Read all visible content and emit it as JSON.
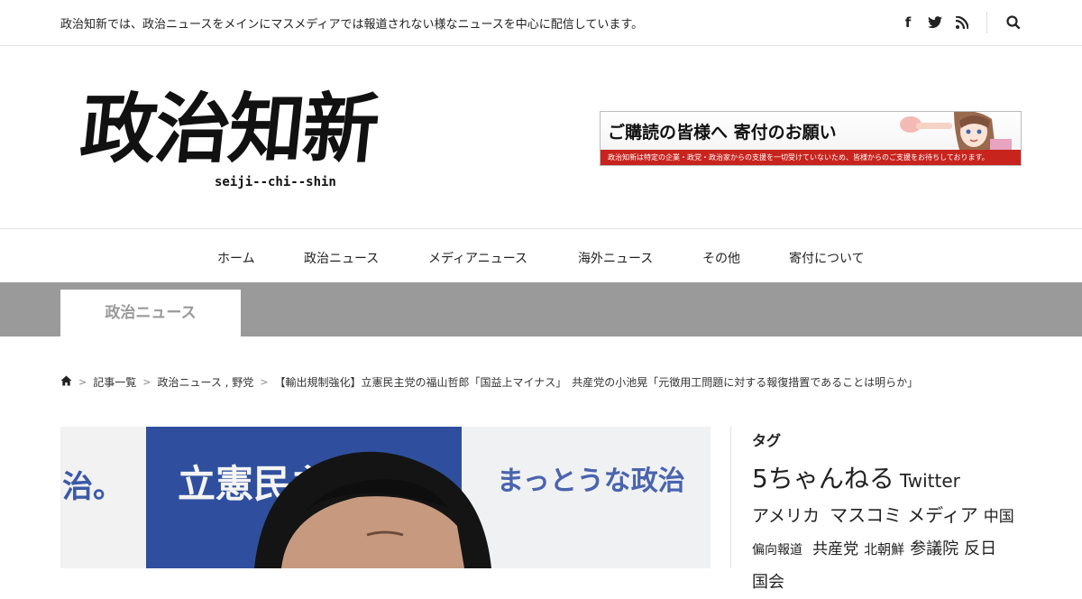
{
  "topbar": {
    "tagline": "政治知新では、政治ニュースをメインにマスメディアでは報道されない様なニュースを中心に配信しています。",
    "icons": [
      "facebook-icon",
      "twitter-icon",
      "rss-icon",
      "search-icon"
    ],
    "facebook_glyph": "f",
    "twitter_glyph": "🐦",
    "rss_glyph": "◉",
    "search_glyph": "⌕"
  },
  "header": {
    "logo_text": "政治知新",
    "logo_subtext": "seiji--chi--shin",
    "banner": {
      "title": "ご購読の皆様へ 寄付のお願い",
      "strip": "政治知新は特定の企業・政党・政治家からの支援を一切受けていないため、皆様からのご支援をお待ちしております。"
    }
  },
  "nav": {
    "items": [
      {
        "label": "ホーム"
      },
      {
        "label": "政治ニュース"
      },
      {
        "label": "メディアニュース"
      },
      {
        "label": "海外ニュース"
      },
      {
        "label": "その他"
      },
      {
        "label": "寄付について"
      }
    ]
  },
  "category": {
    "label": "政治ニュース"
  },
  "breadcrumb": {
    "home_icon": "home-icon",
    "items": [
      {
        "label": "記事一覧"
      },
      {
        "label": "政治ニュース , 野党"
      },
      {
        "label": "【輸出規制強化】立憲民主党の福山哲郎「国益上マイナス」　共産党の小池晃「元徴用工問題に対する報復措置であることは明らか」"
      }
    ]
  },
  "article": {
    "photo_text_left": "治。",
    "photo_text_center": "立憲民主党",
    "photo_text_right": "まっとうな政治"
  },
  "sidebar": {
    "title": "タグ",
    "tags": [
      {
        "label": "5ちゃんねる"
      },
      {
        "label": "Twitter"
      },
      {
        "label": "アメリカ"
      },
      {
        "label": "マスコミ"
      },
      {
        "label": "メディア"
      },
      {
        "label": "中国"
      },
      {
        "label": "偏向報道"
      },
      {
        "label": "共産党"
      },
      {
        "label": "北朝鮮"
      },
      {
        "label": "参議院"
      },
      {
        "label": "反日"
      },
      {
        "label": "国会"
      }
    ]
  },
  "colors": {
    "category_bar": "#9a9a9a",
    "banner_strip": "#c8241e",
    "photo_blue": "#2f4f9e"
  }
}
